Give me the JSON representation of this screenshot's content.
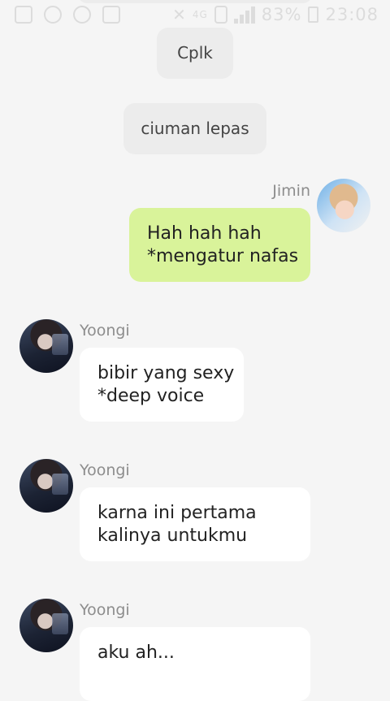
{
  "status_bar": {
    "battery_percent": "83%",
    "network_type": "4G",
    "time": "23:08"
  },
  "messages": [
    {
      "type": "center",
      "text": "Cplk"
    },
    {
      "type": "center",
      "text": "ciuman lepas"
    },
    {
      "type": "outgoing",
      "sender": "Jimin",
      "lines": [
        "Hah hah hah",
        "*mengatur nafas"
      ]
    },
    {
      "type": "incoming",
      "sender": "Yoongi",
      "lines": [
        "bibir yang sexy",
        "*deep voice"
      ]
    },
    {
      "type": "incoming",
      "sender": "Yoongi",
      "lines": [
        "karna ini pertama",
        "kalinya untukmu"
      ]
    },
    {
      "type": "incoming",
      "sender": "Yoongi",
      "lines": [
        "aku ah..."
      ]
    }
  ],
  "colors": {
    "background": "#f5f5f5",
    "outgoing_bubble": "#d9f39a",
    "incoming_bubble": "#ffffff",
    "center_pill": "#ececec"
  }
}
